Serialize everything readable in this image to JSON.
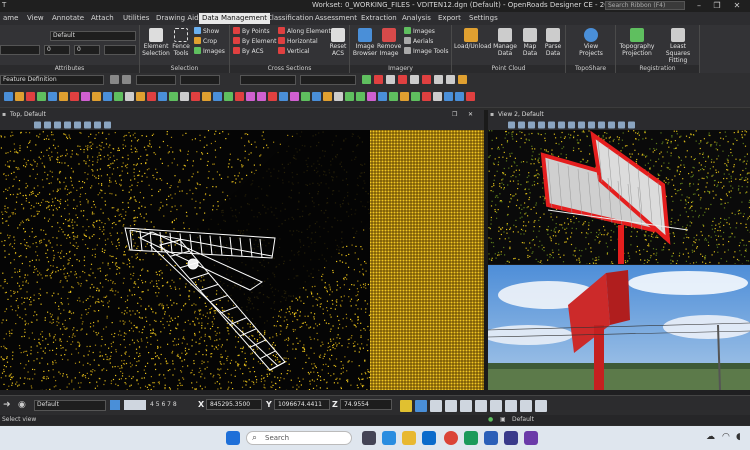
{
  "titlebar": {
    "app": "T",
    "title": "Workset: 0_WORKING_FILES - VDITEN12.dgn (Default) - OpenRoads Designer CE - 2022 Release 3",
    "search_placeholder": "Search Ribbon (F4)"
  },
  "tabs": [
    "ame",
    "View",
    "Annotate",
    "Attach",
    "Utilities",
    "Drawing Aids",
    "Data Management",
    "Classification",
    "Assessment",
    "Extraction",
    "Analysis",
    "Export",
    "Settings"
  ],
  "active_tab": "Data Management",
  "ribbon": {
    "attributes": {
      "label": "Attributes",
      "level": "Default",
      "weight_val": "0",
      "style_val": "0"
    },
    "selection": {
      "label": "Selection",
      "element_selection": "Element Selection",
      "fence_tools": "Fence Tools",
      "show": "Show",
      "crop": "Crop",
      "images": "Images"
    },
    "cross_sections": {
      "label": "Cross Sections",
      "by_points": "By Points",
      "by_element": "By Element",
      "by_acs": "By ACS",
      "along_element": "Along Element",
      "horizontal": "Horizontal",
      "vertical": "Vertical",
      "reset_acs": "Reset ACS"
    },
    "imagery": {
      "label": "Imagery",
      "image_browser": "Image Browser",
      "remove_image": "Remove Image",
      "images": "Images",
      "aerials": "Aerials",
      "image_tools": "Image Tools"
    },
    "point_cloud": {
      "label": "Point Cloud",
      "load_unload": "Load/Unload",
      "manage_data": "Manage Data",
      "map_data": "Map Data",
      "parse_data": "Parse Data"
    },
    "topo": {
      "label": "TopoShare Access",
      "view_projects": "View Projects"
    },
    "registration": {
      "label": "Registration",
      "topography_projection": "Topography Projection",
      "least_squares": "Least Squares Fitting"
    },
    "feature_def": "Feature Definition"
  },
  "views": {
    "view1_title": "Top, Default",
    "view2_title": "View 2, Default"
  },
  "status": {
    "level": "Default",
    "view_numbers": "4 5 6 7 8",
    "x_label": "X",
    "x_value": "845295.3500",
    "y_label": "Y",
    "y_value": "1096674.4411",
    "z_label": "Z",
    "z_value": "74.9554",
    "default_right": "Default",
    "message": "Select view"
  },
  "taskbar": {
    "search_placeholder": "Search"
  },
  "colors": {
    "accent_tab": "#e8e8e8",
    "point_yellow": "#f2cc1a",
    "sign_red": "#e51e1e"
  }
}
